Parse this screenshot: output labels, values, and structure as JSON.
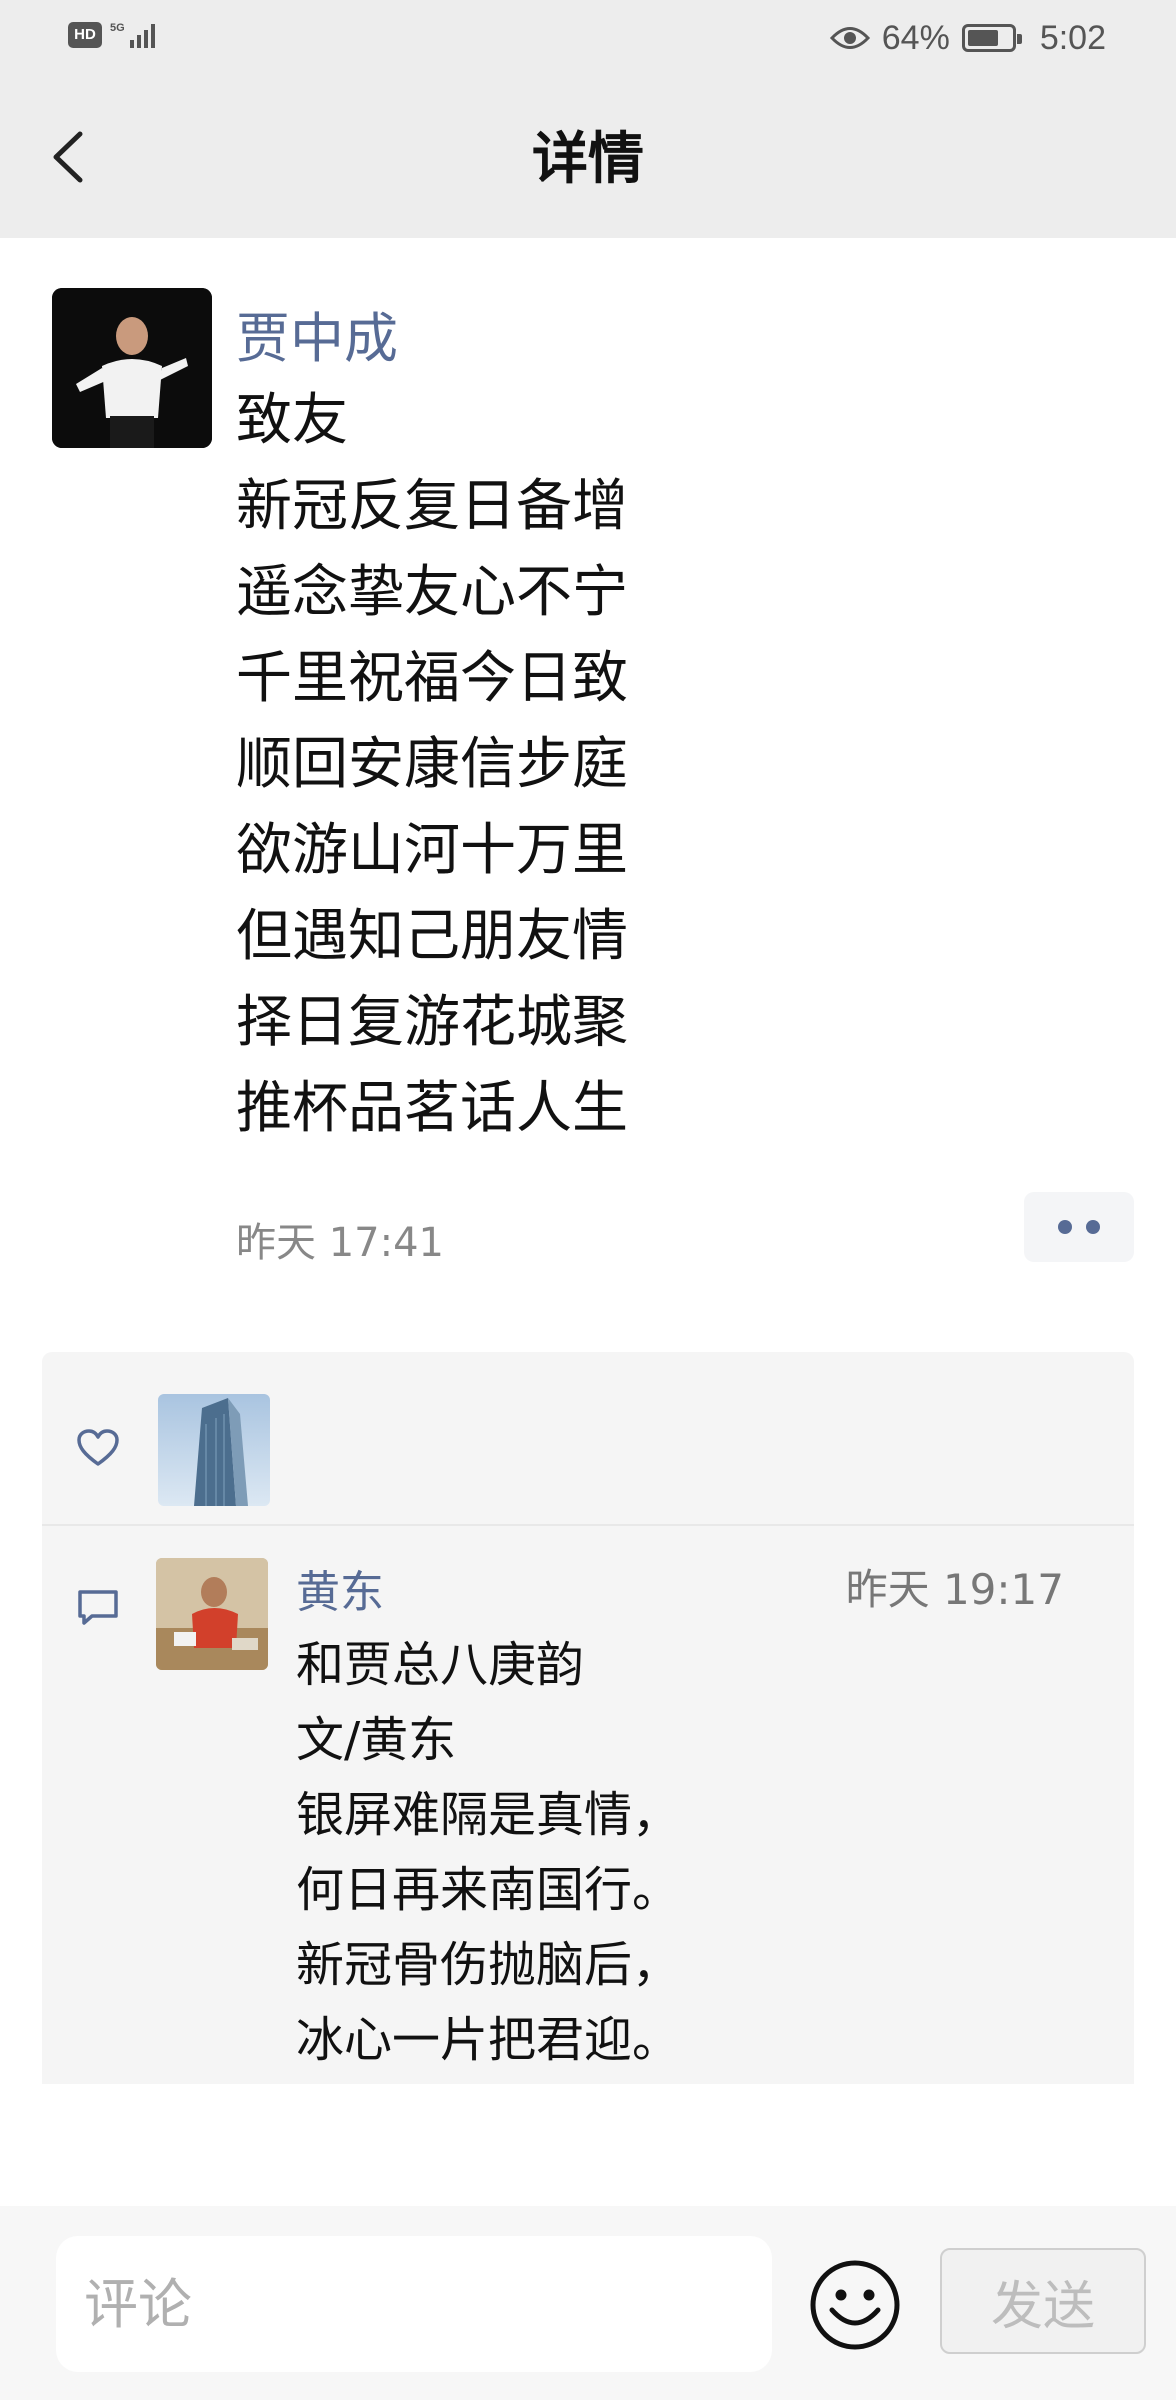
{
  "status_bar": {
    "hd_label": "HD",
    "network_label": "5G",
    "battery_percent": "64%",
    "time": "5:02",
    "icons": [
      "hd-icon",
      "signal-icon",
      "eye-icon",
      "battery-icon"
    ]
  },
  "nav": {
    "title": "详情",
    "back_icon": "chevron-left-icon"
  },
  "post": {
    "author": "贾中成",
    "lines": [
      "致友",
      "新冠反复日备增",
      "遥念挚友心不宁",
      "千里祝福今日致",
      "顺回安康信步庭",
      "欲游山河十万里",
      "但遇知己朋友情",
      "择日复游花城聚",
      "推杯品茗话人生"
    ],
    "time": "昨天 17:41",
    "more_icon": "more-dots-icon"
  },
  "likes": {
    "icon": "heart-icon",
    "count": 1
  },
  "comments": [
    {
      "name": "黄东",
      "time": "昨天 19:17",
      "lines": [
        "和贾总八庚韵",
        "文/黄东",
        "银屏难隔是真情，",
        "何日再来南国行。",
        "新冠骨伤抛脑后，",
        "冰心一片把君迎。"
      ]
    }
  ],
  "comment_bar": {
    "placeholder": "评论",
    "send_label": "发送",
    "emoji_icon": "smiley-icon"
  },
  "colors": {
    "link_blue": "#576b95",
    "panel_bg": "#f5f5f5",
    "header_bg": "#ededed"
  }
}
